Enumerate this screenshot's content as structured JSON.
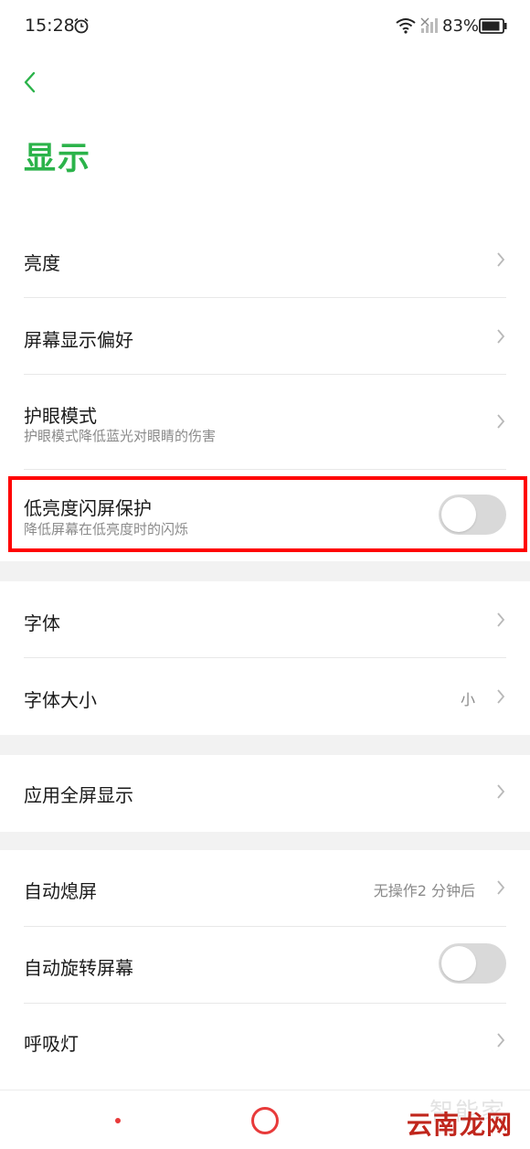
{
  "status_bar": {
    "time": "15:28",
    "battery": "83%",
    "icons": [
      "alarm-icon",
      "wifi-icon",
      "signal-icon",
      "battery-icon"
    ]
  },
  "header": {
    "back_icon": "chevron-left-icon",
    "title": "显示"
  },
  "group1": {
    "brightness": {
      "title": "亮度"
    },
    "screen_pref": {
      "title": "屏幕显示偏好"
    },
    "eye_care": {
      "title": "护眼模式",
      "subtitle": "护眼模式降低蓝光对眼睛的伤害"
    },
    "low_flicker": {
      "title": "低亮度闪屏保护",
      "subtitle": "降低屏幕在低亮度时的闪烁",
      "enabled": false
    }
  },
  "group2": {
    "font": {
      "title": "字体"
    },
    "font_size": {
      "title": "字体大小",
      "value": "小"
    }
  },
  "group3": {
    "fullscreen_apps": {
      "title": "应用全屏显示"
    }
  },
  "group4": {
    "auto_lock": {
      "title": "自动熄屏",
      "value": "无操作2 分钟后"
    },
    "auto_rotate": {
      "title": "自动旋转屏幕",
      "enabled": false
    },
    "breathing_light": {
      "title": "呼吸灯"
    }
  },
  "watermark": {
    "top": "智能家",
    "bottom": "云南龙网"
  },
  "colors": {
    "accent": "#2bb34a",
    "highlight": "#ff0000",
    "nav": "#e83a3a",
    "toggle_off": "#d9d9d9"
  }
}
